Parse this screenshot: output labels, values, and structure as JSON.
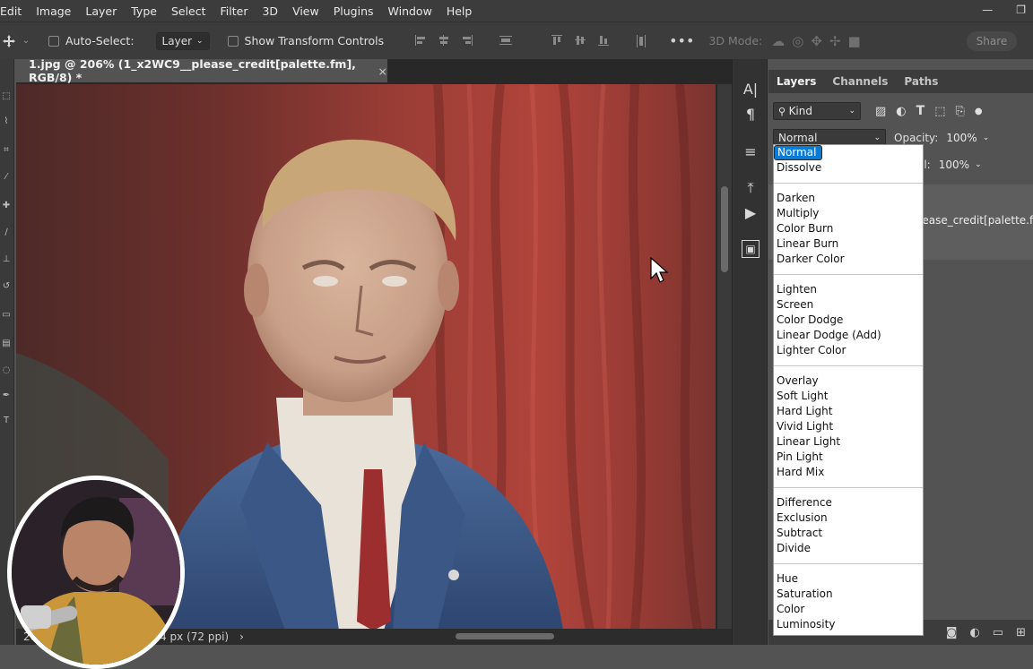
{
  "menu": [
    "Edit",
    "Image",
    "Layer",
    "Type",
    "Select",
    "Filter",
    "3D",
    "View",
    "Plugins",
    "Window",
    "Help"
  ],
  "window_controls": {
    "minimize": "—",
    "maximize": "❐"
  },
  "options_bar": {
    "auto_select_label": "Auto-Select:",
    "auto_select_target": "Layer",
    "show_transform_label": "Show Transform Controls",
    "mode_3d_label": "3D Mode:",
    "share_label": "Share"
  },
  "document": {
    "tab_title": "1.jpg @ 206% (1_x2WC9__please_credit[palette.fm], RGB/8) *",
    "close_glyph": "×"
  },
  "status": {
    "zoom": "205.84%",
    "doc_info": "2468 px x 3674 px (72 ppi)",
    "arrow": "›"
  },
  "panel": {
    "tabs": [
      "Layers",
      "Channels",
      "Paths"
    ],
    "active_tab": "Layers",
    "filter_kind": "Kind",
    "blend_mode_value": "Normal",
    "opacity_label": "Opacity:",
    "opacity_value": "100%",
    "fill_label": "ll:",
    "fill_value": "100%",
    "layer_name_partial": "lease_credit[palette.fm]"
  },
  "blend_menu": {
    "groups": [
      [
        "Normal",
        "Dissolve"
      ],
      [
        "Darken",
        "Multiply",
        "Color Burn",
        "Linear Burn",
        "Darker Color"
      ],
      [
        "Lighten",
        "Screen",
        "Color Dodge",
        "Linear Dodge (Add)",
        "Lighter Color"
      ],
      [
        "Overlay",
        "Soft Light",
        "Hard Light",
        "Vivid Light",
        "Linear Light",
        "Pin Light",
        "Hard Mix"
      ],
      [
        "Difference",
        "Exclusion",
        "Subtract",
        "Divide"
      ],
      [
        "Hue",
        "Saturation",
        "Color",
        "Luminosity"
      ]
    ],
    "selected": "Normal"
  },
  "colors": {
    "selection_blue": "#0a7bd7",
    "curtain_red": "#8d3a35",
    "suit_blue": "#3d5b8a",
    "tie_red": "#9c2e2f"
  },
  "icons": [
    "move-tool-icon",
    "chevron-down-icon",
    "align-icons",
    "more-icon",
    "3d-icons",
    "search-icon",
    "text-tool-icon",
    "paragraph-icon",
    "adjust-icon",
    "play-icon",
    "properties-icon",
    "panel-footer-icons"
  ]
}
